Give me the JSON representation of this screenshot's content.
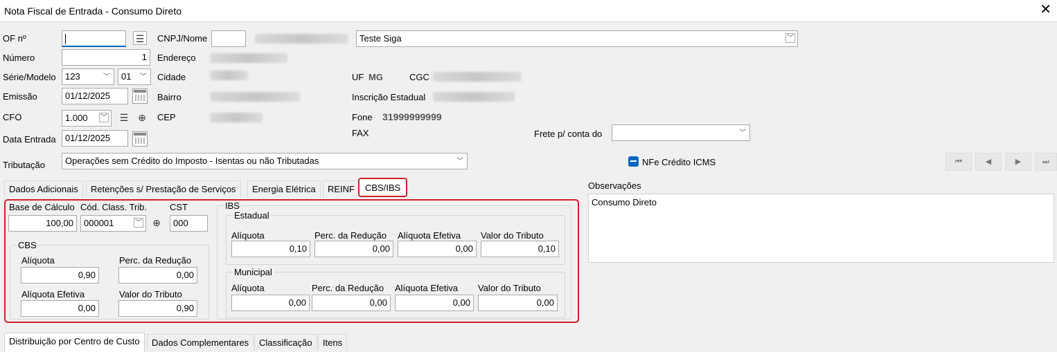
{
  "window": {
    "title": "Nota Fiscal de Entrada - Consumo Direto",
    "close_label": "✕"
  },
  "header": {
    "of_label": "OF nº",
    "of_value": "",
    "cnpj_label": "CNPJ/Nome",
    "supplier_name": "Teste Siga",
    "numero_label": "Número",
    "numero_value": "1",
    "endereco_label": "Endereço",
    "serie_label": "Série/Modelo",
    "serie_value": "123",
    "modelo_value": "01",
    "cidade_label": "Cidade",
    "uf_label": "UF",
    "uf_value": "MG",
    "cgc_label": "CGC",
    "emissao_label": "Emissão",
    "emissao_value": "01/12/2025",
    "bairro_label": "Bairro",
    "ie_label": "Inscrição Estadual",
    "cfo_label": "CFO",
    "cfo_value": "1.000",
    "cep_label": "CEP",
    "fone_label": "Fone",
    "fone_value": "31999999999",
    "fax_label": "FAX",
    "frete_label": "Frete p/ conta do",
    "frete_value": "",
    "data_entrada_label": "Data Entrada",
    "data_entrada_value": "01/12/2025",
    "tributacao_label": "Tributação",
    "tributacao_value": "Operações sem Crédito do Imposto - Isentas ou não Tributadas",
    "nfe_credito_label": "NFe Crédito ICMS"
  },
  "tabs_top": [
    "Dados Adicionais",
    "Retenções s/ Prestação de Serviços",
    "Energia Elétrica",
    "REINF",
    "CBS/IBS"
  ],
  "cbs_ibs": {
    "base_calculo_label": "Base de Cálculo",
    "base_calculo_value": "100,00",
    "cod_class_label": "Cód. Class. Trib.",
    "cod_class_value": "000001",
    "cst_label": "CST",
    "cst_value": "000",
    "cbs": {
      "title": "CBS",
      "aliquota_label": "Alíquota",
      "aliquota_value": "0,90",
      "perc_reducao_label": "Perc. da Redução",
      "perc_reducao_value": "0,00",
      "aliquota_efetiva_label": "Alíquota Efetiva",
      "aliquota_efetiva_value": "0,00",
      "valor_tributo_label": "Valor do Tributo",
      "valor_tributo_value": "0,90"
    },
    "ibs": {
      "title": "IBS",
      "estadual": {
        "title": "Estadual",
        "aliquota_label": "Alíquota",
        "aliquota_value": "0,10",
        "perc_reducao_label": "Perc. da Redução",
        "perc_reducao_value": "0,00",
        "aliquota_efetiva_label": "Alíquota Efetiva",
        "aliquota_efetiva_value": "0,00",
        "valor_tributo_label": "Valor do Tributo",
        "valor_tributo_value": "0,10"
      },
      "municipal": {
        "title": "Municipal",
        "aliquota_label": "Alíquota",
        "aliquota_value": "0,00",
        "perc_reducao_label": "Perc. da Redução",
        "perc_reducao_value": "0,00",
        "aliquota_efetiva_label": "Alíquota Efetiva",
        "aliquota_efetiva_value": "0,00",
        "valor_tributo_label": "Valor do Tributo",
        "valor_tributo_value": "0,00"
      }
    }
  },
  "observacoes": {
    "label": "Observações",
    "text": "Consumo Direto"
  },
  "tabs_bottom": [
    "Distribuição por Centro de Custo",
    "Dados Complementares",
    "Classificação",
    "Itens"
  ],
  "nav": {
    "first": "⏮",
    "prev": "◀",
    "next": "▶",
    "last": "⏭"
  },
  "colors": {
    "accent": "#0067c0",
    "highlight": "#d21f2b"
  }
}
